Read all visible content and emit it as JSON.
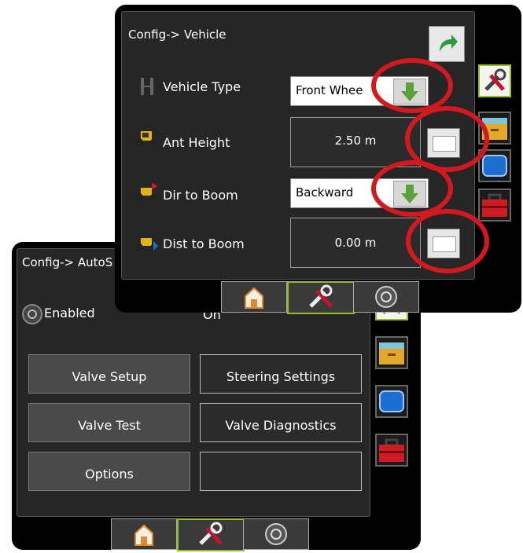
{
  "back_screen": {
    "title": "Config-> AutoS",
    "enabled_label": "Enabled",
    "enabled_value": "On",
    "buttons": [
      "Valve Setup",
      "Steering Settings",
      "Valve Test",
      "Valve Diagnostics",
      "Options",
      ""
    ]
  },
  "front_screen": {
    "title": "Config-> Vehicle",
    "rows": [
      {
        "label": "Vehicle Type",
        "value": "Front Whee",
        "control": "dropdown",
        "icon": "vehicle-axle-icon"
      },
      {
        "label": "Ant Height",
        "value": "2.50 m",
        "control": "keypad",
        "icon": "tractor-antenna-icon"
      },
      {
        "label": "Dir to Boom",
        "value": "Backward",
        "control": "dropdown",
        "icon": "tractor-direction-icon"
      },
      {
        "label": "Dist to Boom",
        "value": "0.00 m",
        "control": "keypad",
        "icon": "tractor-distance-icon"
      }
    ]
  },
  "side_tabs": [
    "tools-icon",
    "file-cabinet-icon",
    "blue-screen-icon",
    "red-toolbox-icon"
  ],
  "bottom_tabs": [
    "home-icon",
    "tools-icon",
    "steering-wheel-icon"
  ],
  "colors": {
    "accent": "#95c11f",
    "highlight": "#d3191f",
    "panel": "#262626"
  }
}
